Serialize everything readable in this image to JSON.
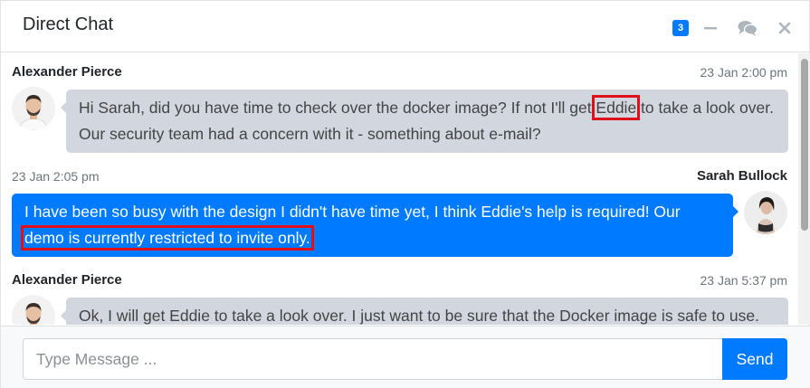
{
  "header": {
    "title": "Direct Chat",
    "badge": "3",
    "tools": [
      "minus-icon",
      "comments-icon",
      "close-icon"
    ]
  },
  "messages": [
    {
      "name": "Alexander Pierce",
      "time": "23 Jan 2:00 pm",
      "side": "left",
      "text_before": "Hi Sarah, did you have time to check over the docker image? If not I'll get ",
      "highlight": "Eddie",
      "text_after": " to take a look over. Our security team had a concern with it - something about e-mail?"
    },
    {
      "name": "Sarah Bullock",
      "time": "23 Jan 2:05 pm",
      "side": "right",
      "line1": "I have been so busy with the design I didn't have time yet, I think Eddie's help is required! Our",
      "highlight": "demo is currently restricted to invite only."
    },
    {
      "name": "Alexander Pierce",
      "time": "23 Jan 5:37 pm",
      "side": "left",
      "text": "Ok, I will get Eddie to take a look over. I just want to be sure that the Docker image is safe to use."
    }
  ],
  "footer": {
    "placeholder": "Type Message ...",
    "send_label": "Send"
  },
  "colors": {
    "primary": "#007bff",
    "bubble_left": "#d2d6de",
    "highlight_box": "#e0101a"
  }
}
